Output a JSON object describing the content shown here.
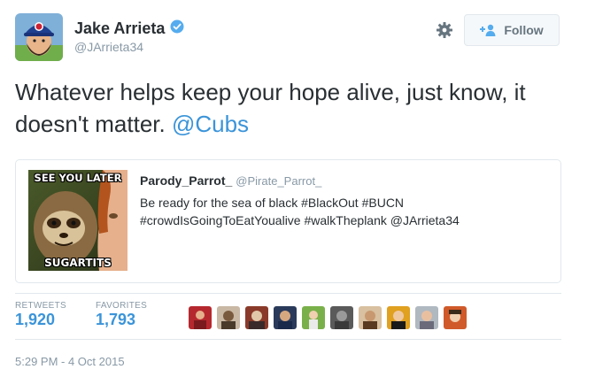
{
  "author": {
    "name": "Jake Arrieta",
    "handle": "@JArrieta34"
  },
  "follow_label": "Follow",
  "tweet": {
    "text": "Whatever helps keep your hope alive, just know, it doesn't matter. ",
    "mention": "@Cubs"
  },
  "quoted": {
    "name": "Parody_Parrot_",
    "handle": "@Pirate_Parrot_",
    "text": "Be ready for the sea of black #BlackOut #BUCN #crowdIsGoingToEatYoualive #walkTheplank @JArrieta34",
    "image_text_top": "SEE YOU LATER",
    "image_text_bottom": "SUGARTITS"
  },
  "stats": {
    "retweets_label": "RETWEETS",
    "retweets": "1,920",
    "favorites_label": "FAVORITES",
    "favorites": "1,793"
  },
  "timestamp": "5:29 PM - 4 Oct 2015",
  "colors": {
    "link": "#3b94d9",
    "verified": "#55acee",
    "muted": "#8899a6"
  },
  "icons": [
    "verified-icon",
    "gear-icon",
    "follow-person-plus-icon"
  ]
}
